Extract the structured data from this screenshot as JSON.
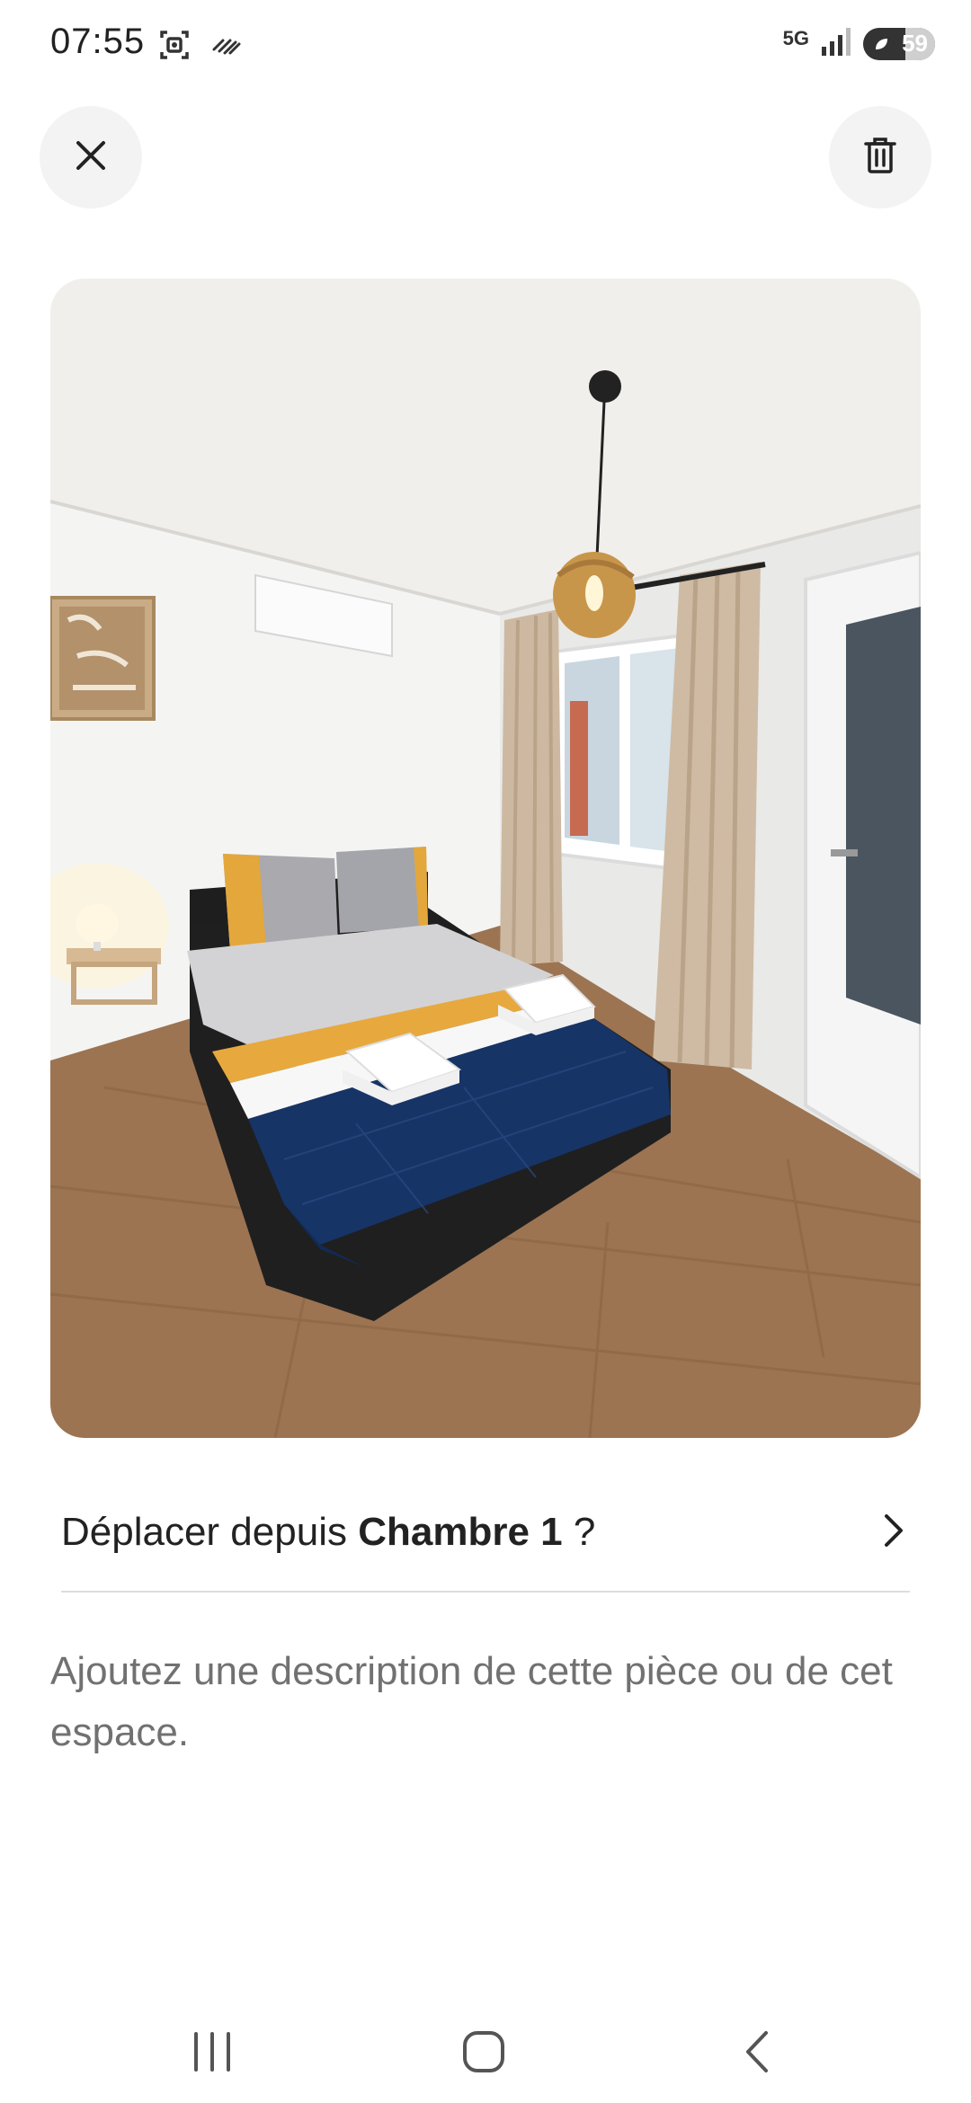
{
  "status_bar": {
    "time": "07:55",
    "network": "5G",
    "battery_level": "59",
    "battery_fraction": 0.59
  },
  "toolbar": {
    "close_icon": "close-icon",
    "delete_icon": "trash-icon"
  },
  "photo": {
    "subject": "bedroom"
  },
  "move_row": {
    "prefix": "Déplacer depuis ",
    "room": "Chambre 1",
    "suffix": " ?",
    "icon": "chevron-right-icon"
  },
  "description": {
    "placeholder": "Ajoutez une description de cette pièce ou de cet espace."
  },
  "nav": {
    "recents_icon": "recents-icon",
    "home_icon": "home-icon",
    "back_icon": "back-icon"
  },
  "colors": {
    "text": "#222222",
    "muted": "#717171",
    "button_bg": "#f3f3f3",
    "divider": "#dddddd"
  }
}
